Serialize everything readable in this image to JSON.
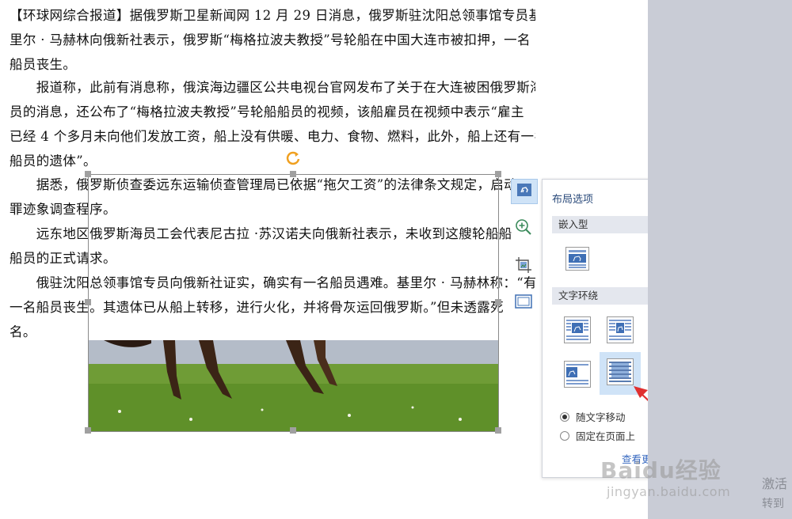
{
  "document": {
    "paragraphs": [
      [
        "【环球网综合报道】据俄罗斯卫星新闻网 12 月 29 日消息，俄罗斯驻沈阳总领事馆专员基",
        "里尔 · 马赫林向俄新社表示，俄罗斯“梅格拉波夫教授”号轮船在中国大连市被扣押，一名",
        "船员丧生。"
      ],
      [
        "　　报道称，此前有消息称，俄滨海边疆区公共电视台官网发布了关于在大连被困俄罗斯海",
        "员的消息，还公布了“梅格拉波夫教授”号轮船船员的视频，该船雇员在视频中表示“雇主",
        "已经 4 个多月未向他们发放工资，船上没有供暖、电力、食物、燃料，此外，船上还有一名",
        "船员的遗体”。"
      ],
      [
        "　　据悉，俄罗斯侦查委远东运输侦查管理局已依据“拖欠工资”的法律条文规定，启动",
        "罪迹象调查程序。"
      ],
      [
        "　　远东地区俄罗斯海员工会代表尼古拉 ·苏汉诺夫向俄新社表示，未收到这艘轮船船",
        "船员的正式请求。"
      ],
      [
        "　　俄驻沈阳总领事馆专员向俄新社证实，确实有一名船员遇难。基里尔 · 马赫林称：“有",
        "一名船员丧生。其遗体已从船上转移，进行火化，并将骨灰运回俄罗斯。”但未透露死",
        "名。"
      ]
    ]
  },
  "toolbar": {
    "buttons": [
      {
        "icon": "layout-options-icon"
      },
      {
        "icon": "zoom-in-icon"
      },
      {
        "icon": "crop-image-icon"
      },
      {
        "icon": "border-frame-icon"
      }
    ]
  },
  "layout_panel": {
    "title": "布局选项",
    "close_icon": "close-icon",
    "inline_section_label": "嵌入型",
    "wrap_section_label": "文字环绕",
    "radio_move_with_text": "随文字移动",
    "radio_fixed_position": "固定在页面上",
    "radio_selected": "move_with_text",
    "see_more": "查看更多..."
  },
  "watermark": {
    "brand": "Baidu经验",
    "site": "jingyan.baidu.com"
  },
  "activation": {
    "line1": "激活",
    "line2": "转到"
  },
  "colors": {
    "accent": "#3a6bc1",
    "selected_bg": "#cfe3f7",
    "annotation": "#e03030",
    "gutter": "#c9ccd6"
  }
}
